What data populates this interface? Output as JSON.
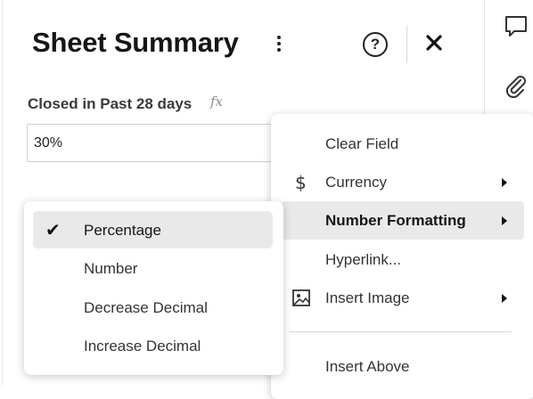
{
  "panel": {
    "title": "Sheet Summary",
    "menu_icon": "more-vertical-icon",
    "help_label": "?",
    "close_icon": "close-icon"
  },
  "field": {
    "label": "Closed in Past 28 days",
    "formula_icon_label": "fx",
    "value": "30%"
  },
  "context_menu": {
    "items": [
      {
        "label": "Clear Field",
        "icon": ""
      },
      {
        "label": "Currency",
        "icon": "dollar-icon",
        "has_submenu": true
      },
      {
        "label": "Number Formatting",
        "icon": "",
        "has_submenu": true,
        "active": true
      },
      {
        "label": "Hyperlink...",
        "icon": ""
      },
      {
        "label": "Insert Image",
        "icon": "image-icon",
        "has_submenu": true
      },
      {
        "label": "Insert Above",
        "icon": ""
      }
    ]
  },
  "number_formatting_submenu": {
    "items": [
      {
        "label": "Percentage",
        "checked": true
      },
      {
        "label": "Number",
        "checked": false
      },
      {
        "label": "Decrease Decimal",
        "checked": false
      },
      {
        "label": "Increase Decimal",
        "checked": false
      }
    ]
  },
  "right_rail": {
    "icons": [
      "comment-icon",
      "attachment-icon"
    ]
  }
}
